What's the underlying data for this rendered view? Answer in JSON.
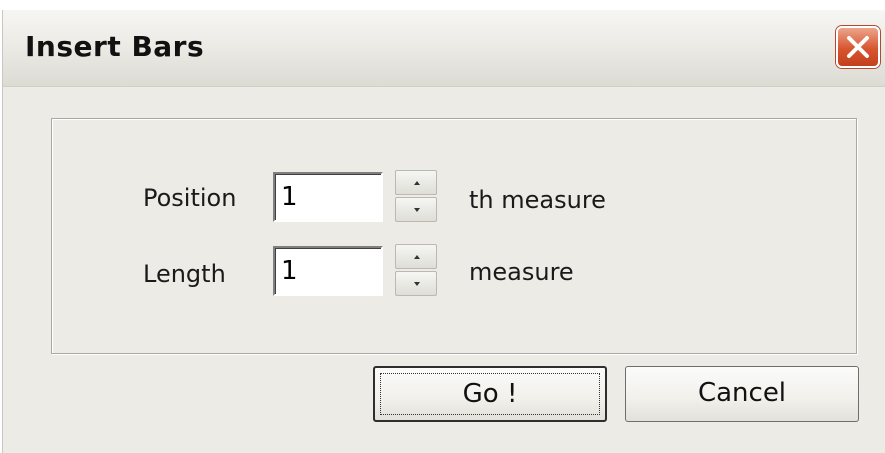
{
  "window": {
    "title": "Insert Bars"
  },
  "icons": {
    "close": "close-icon",
    "spin_up": "arrow-up-icon",
    "spin_down": "arrow-down-icon"
  },
  "form": {
    "position": {
      "label": "Position",
      "value": "1",
      "suffix": "th measure"
    },
    "length": {
      "label": "Length",
      "value": "1",
      "suffix": "measure"
    }
  },
  "buttons": {
    "go": "Go !",
    "cancel": "Cancel"
  },
  "colors": {
    "dialog_bg": "#ecebe6",
    "close_button": "#d8552f"
  }
}
